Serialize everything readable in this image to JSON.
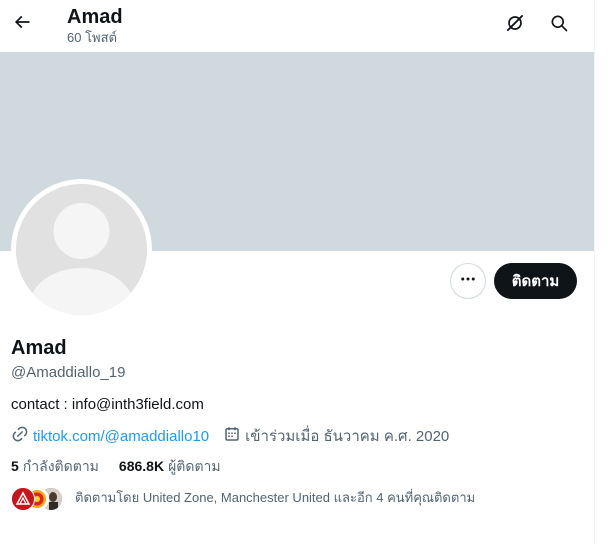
{
  "header": {
    "name": "Amad",
    "posts_count": "60 โพสต์"
  },
  "profile": {
    "display_name": "Amad",
    "handle": "@Amaddiallo_19",
    "bio": "contact : info@inth3field.com",
    "website": "tiktok.com/@amaddiallo10",
    "joined": "เข้าร่วมเมื่อ ธันวาคม ค.ศ. 2020"
  },
  "actions": {
    "follow_label": "ติดตาม"
  },
  "stats": {
    "following_count": "5",
    "following_label": "กำลังติดตาม",
    "followers_count": "686.8K",
    "followers_label": "ผู้ติดตาม"
  },
  "followed_by": {
    "text": "ติดตามโดย United Zone, Manchester United และอีก 4 คนที่คุณติดตาม"
  },
  "icons": {
    "back": "arrow-left-icon",
    "grok": "grok-icon",
    "search": "search-icon",
    "more": "more-dots-icon",
    "link": "link-icon",
    "calendar": "calendar-icon"
  },
  "colors": {
    "banner": "#cfd9de",
    "link": "#1d9bf0",
    "button": "#0f1419",
    "secondary_text": "#536471"
  }
}
